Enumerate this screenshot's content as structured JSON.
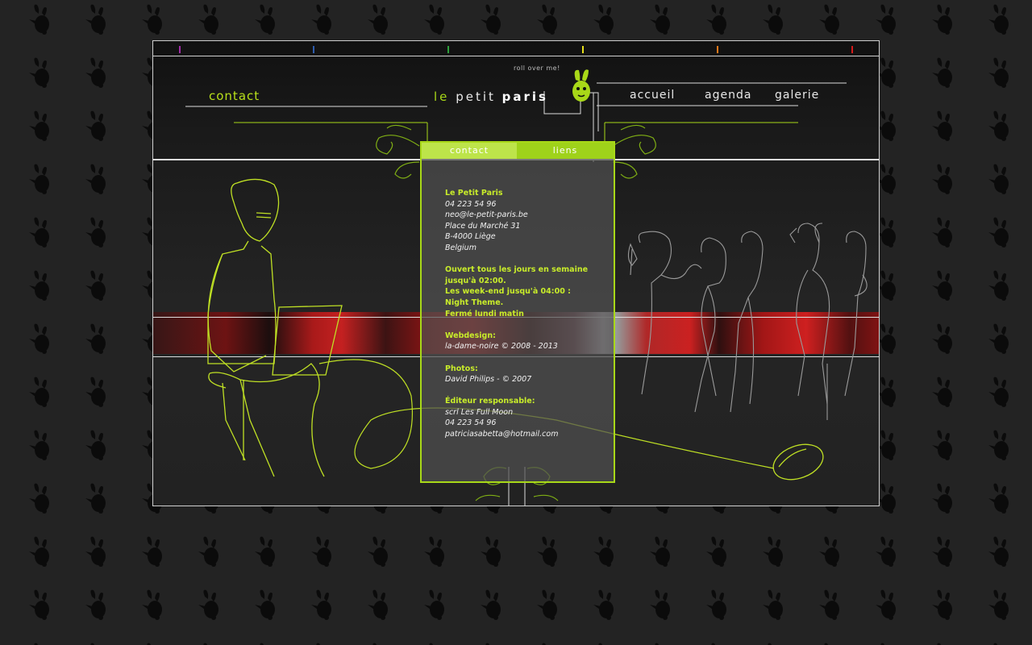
{
  "colors": {
    "accent_green": "#a8d818",
    "background": "#232323",
    "tick_colors": [
      "#a12ca8",
      "#2d5cae",
      "#2ea03c",
      "#e8e01a",
      "#e8781a",
      "#d81a1a"
    ]
  },
  "logo": {
    "le": "le",
    "petit": "petit",
    "paris": "paris",
    "rollover": "roll over me!"
  },
  "nav": {
    "accueil": "accueil",
    "agenda": "agenda",
    "galerie": "galerie"
  },
  "page_title": "contact",
  "tabs": {
    "contact": "contact",
    "liens": "liens"
  },
  "contact_info": {
    "venue_name": "Le Petit Paris",
    "phone": "04 223 54 96",
    "email": "neo@le-petit-paris.be",
    "street": "Place du Marché 31",
    "city": "B-4000 Liège",
    "country": "Belgium",
    "hours_1": "Ouvert tous les jours en semaine",
    "hours_2": "jusqu'à 02:00.",
    "hours_3": "Les week-end jusqu'à 04:00 :",
    "hours_4": "Night Theme.",
    "hours_5": "Fermé lundi matin",
    "webdesign_label": "Webdesign:",
    "webdesign_value": "la-dame-noire © 2008 - 2013",
    "photos_label": "Photos:",
    "photos_value": "David Philips - © 2007",
    "editor_label": "Éditeur responsable:",
    "editor_org": "scrl Les Full Moon",
    "editor_phone": "04 223 54 96",
    "editor_email": "patriciasabetta@hotmail.com"
  },
  "icons": [
    "bunny-mascot-icon",
    "bunny-pattern-icon",
    "ornament-flourish-icon",
    "computer-mouse-icon"
  ]
}
